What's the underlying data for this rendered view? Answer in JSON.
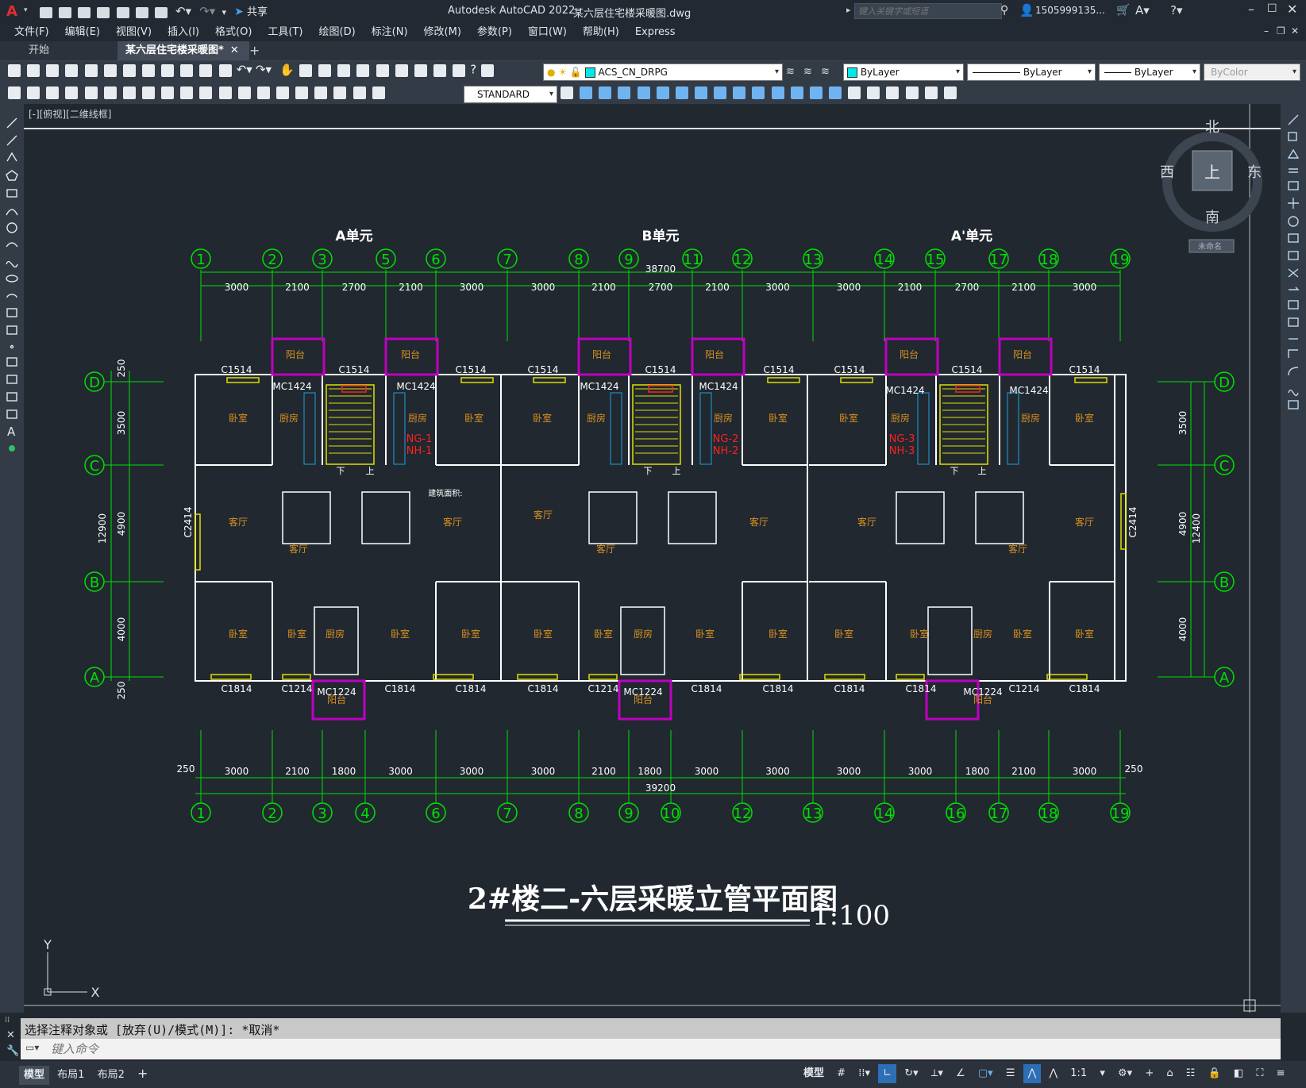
{
  "app": {
    "title": "Autodesk AutoCAD 2022",
    "filename": "某六层住宅楼采暖图.dwg",
    "share_label": "共享",
    "search_placeholder": "键入关键字或短语",
    "user": "1505999135...",
    "logo": "A"
  },
  "menu": [
    "文件(F)",
    "编辑(E)",
    "视图(V)",
    "插入(I)",
    "格式(O)",
    "工具(T)",
    "绘图(D)",
    "标注(N)",
    "修改(M)",
    "参数(P)",
    "窗口(W)",
    "帮助(H)",
    "Express"
  ],
  "tabs": [
    {
      "label": "开始"
    },
    {
      "label": "某六层住宅楼采暖图*"
    }
  ],
  "toolbar": {
    "layer": "ACS_CN_DRPG",
    "color": "ByLayer",
    "linetype": "ByLayer",
    "lineweight": "ByLayer",
    "plotstyle": "ByColor",
    "textstyle": "STANDARD"
  },
  "viewport": {
    "label": "[-][俯视][二维线框]",
    "viewcube": {
      "north": "北",
      "south": "南",
      "east": "东",
      "west": "西",
      "face": "上",
      "ucs": "未命名"
    }
  },
  "drawing": {
    "title": "2#楼二-六层采暖立管平面图",
    "scale": "1:100",
    "units": [
      "A单元",
      "B单元",
      "A'单元"
    ],
    "top_axes": [
      "1",
      "2",
      "3",
      "5",
      "6",
      "7",
      "8",
      "9",
      "11",
      "12",
      "13",
      "14",
      "15",
      "17",
      "18",
      "19"
    ],
    "bottom_axes": [
      "1",
      "2",
      "3",
      "4",
      "6",
      "7",
      "8",
      "9",
      "10",
      "12",
      "13",
      "14",
      "16",
      "17",
      "18",
      "19"
    ],
    "row_axes": [
      "D",
      "C",
      "B",
      "A"
    ],
    "top_total": "38700",
    "top_dims": [
      "3000",
      "2100",
      "2700",
      "2100",
      "3000",
      "3000",
      "2100",
      "2700",
      "2100",
      "3000",
      "3000",
      "2100",
      "2700",
      "2100",
      "3000"
    ],
    "bottom_total": "39200",
    "bottom_dims": [
      "3000",
      "2100",
      "1800",
      "3000",
      "3000",
      "3000",
      "2100",
      "1800",
      "3000",
      "3000",
      "3000",
      "3000",
      "1800",
      "2100",
      "3000"
    ],
    "bottom_edge_dim": "250",
    "left_dims": [
      "250",
      "3500",
      "4900",
      "4000",
      "250"
    ],
    "left_total": "12900",
    "right_dims": [
      "3500",
      "4900",
      "4000"
    ],
    "right_total": "12400",
    "windows_top": [
      "C1514",
      "C1514",
      "C1514",
      "C1514",
      "C1514",
      "C1514",
      "C1514",
      "C1514",
      "C1514"
    ],
    "windows_bottom": [
      "C1814",
      "C1214",
      "C1814",
      "C1814",
      "C1814",
      "C1214",
      "C1814",
      "C1814",
      "C1814",
      "C1814",
      "C1214",
      "C1814"
    ],
    "doors": [
      "MC1424",
      "MC1424",
      "MC1424",
      "MC1424",
      "MC1424",
      "MC1424",
      "MC1224",
      "MC1224",
      "MC1224"
    ],
    "side_windows": [
      "C2414",
      "C2414"
    ],
    "room_labels": {
      "bedroom": "卧室",
      "kitchen": "厨房",
      "living": "客厅",
      "balcony": "阳台",
      "down": "下",
      "up": "上"
    },
    "risers": [
      "NG-1",
      "NH-1",
      "NG-2",
      "NH-2",
      "NG-3",
      "NH-3"
    ],
    "area_note": "建筑面积:"
  },
  "command": {
    "history": "选择注释对象或 [放弃(U)/模式(M)]: *取消*",
    "placeholder": "键入命令"
  },
  "layout_tabs": [
    "模型",
    "布局1",
    "布局2"
  ],
  "status": {
    "model": "模型",
    "scale": "1:1"
  },
  "colors": {
    "axis_green": "#00e000",
    "wall": "#ffffff",
    "magenta": "#c000c0",
    "yellow": "#e0e000",
    "room_text": "#d89020",
    "red": "#ff2020",
    "cyan": "#20a0e0"
  }
}
